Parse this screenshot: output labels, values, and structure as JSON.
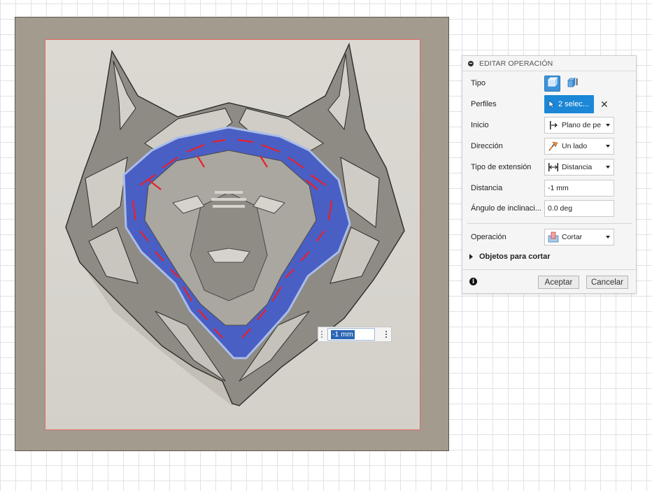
{
  "panel": {
    "title": "EDITAR OPERACIÓN",
    "rows": {
      "tipo": {
        "label": "Tipo"
      },
      "perfiles": {
        "label": "Perfiles",
        "value": "2 selec..."
      },
      "inicio": {
        "label": "Inicio",
        "value": "Plano de pe"
      },
      "direccion": {
        "label": "Dirección",
        "value": "Un lado"
      },
      "tipo_extension": {
        "label": "Tipo de extensión",
        "value": "Distancia"
      },
      "distancia": {
        "label": "Distancia",
        "value": "-1 mm"
      },
      "angulo": {
        "label": "Ángulo de inclinaci...",
        "value": "0.0 deg"
      },
      "operacion": {
        "label": "Operación",
        "value": "Cortar"
      }
    },
    "objects_section": "Objetos para cortar",
    "ok_label": "Aceptar",
    "cancel_label": "Cancelar"
  },
  "canvas": {
    "inline_distance_value": "-1 mm"
  },
  "colors": {
    "accent": "#1b87d6",
    "selected_profile": "#4a5fc4",
    "profile_edge": "#e8202a",
    "plate": "#a29b8e",
    "face": "#dcd9d3"
  },
  "icons": {
    "tipo_solid": "extrude-solid-icon",
    "tipo_thin": "extrude-thin-icon",
    "perfiles": "cursor-select-icon",
    "clear": "close-icon",
    "inicio": "profile-plane-icon",
    "direccion": "one-side-direction-icon",
    "tipo_extension": "distance-extent-icon",
    "operacion": "cut-operation-icon",
    "info": "info-icon"
  }
}
